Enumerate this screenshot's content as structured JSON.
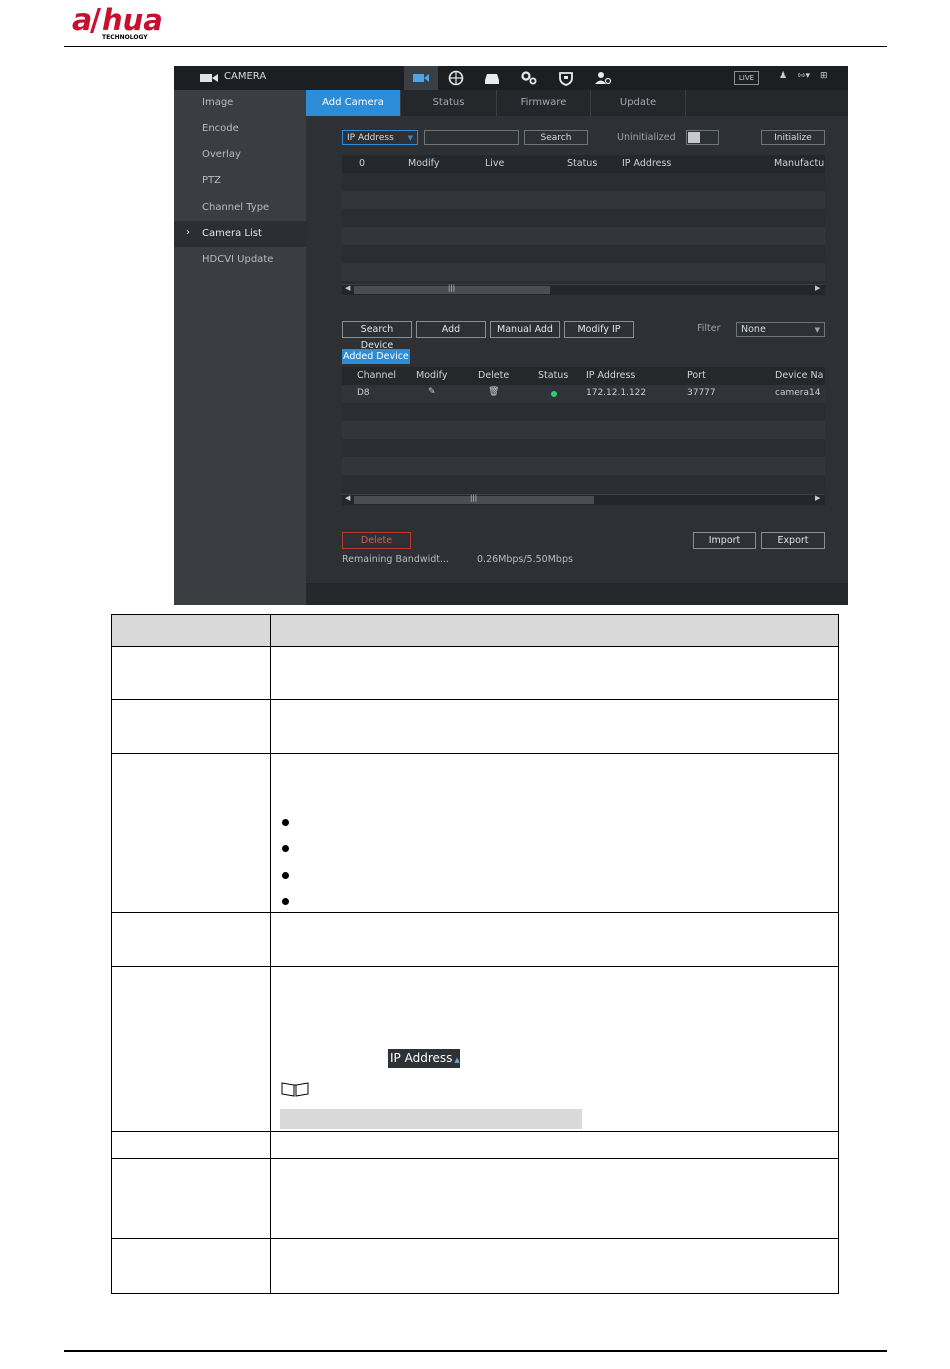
{
  "brand": {
    "logo_text": "alhua",
    "logo_subtext": "TECHNOLOGY"
  },
  "ui": {
    "module_title": "CAMERA",
    "top_icons": [
      "camera-icon",
      "network-icon",
      "storage-icon",
      "system-icon",
      "security-icon",
      "account-icon"
    ],
    "live_label": "LIVE",
    "sidebar": {
      "items": [
        {
          "label": "Image"
        },
        {
          "label": "Encode"
        },
        {
          "label": "Overlay"
        },
        {
          "label": "PTZ"
        },
        {
          "label": "Channel Type"
        },
        {
          "label": "Camera List"
        },
        {
          "label": "HDCVI Update"
        }
      ],
      "active_index": 5
    },
    "tabs": [
      {
        "label": "Add Camera"
      },
      {
        "label": "Status"
      },
      {
        "label": "Firmware"
      },
      {
        "label": "Update"
      }
    ],
    "search_bar": {
      "ip_select": "IP Address",
      "search_value": "",
      "search_button": "Search",
      "uninitialized_label": "Uninitialized",
      "initialize_button": "Initialize"
    },
    "device_list": {
      "columns": [
        "0",
        "Modify",
        "Live",
        "Status",
        "IP Address",
        "Manufactu"
      ]
    },
    "actions": {
      "search_device": "Search Device",
      "add": "Add",
      "manual_add": "Manual Add",
      "modify_ip": "Modify IP",
      "filter_label": "Filter",
      "filter_value": "None"
    },
    "added_device": {
      "label": "Added Device",
      "columns": [
        "Channel",
        "Modify",
        "Delete",
        "Status",
        "IP Address",
        "Port",
        "Device Na"
      ],
      "rows": [
        {
          "channel": "D8",
          "status": "online",
          "ip": "172.12.1.122",
          "port": "37777",
          "device_name": "camera14"
        }
      ]
    },
    "footer": {
      "delete_button": "Delete",
      "import_button": "Import",
      "export_button": "Export",
      "bandwidth_label": "Remaining Bandwidt...",
      "bandwidth_value": "0.26Mbps/5.50Mbps"
    }
  },
  "doc_table": {
    "inline_ip_label": "IP Address"
  }
}
